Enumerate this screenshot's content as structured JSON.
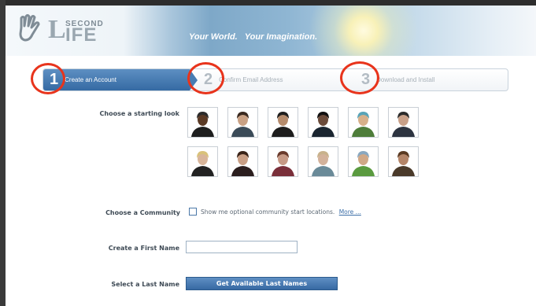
{
  "header": {
    "logo_second": "SECOND",
    "logo_life": "LIFE",
    "tagline": "Your World.   Your Imagination."
  },
  "steps": [
    {
      "number": "1",
      "label": "Create an Account",
      "active": true
    },
    {
      "number": "2",
      "label": "Confirm Email Address",
      "active": false
    },
    {
      "number": "3",
      "label": "Download and Install",
      "active": false
    }
  ],
  "form": {
    "look_label": "Choose a starting look",
    "avatars": [
      "avatar-man-suit",
      "avatar-woman-sunglasses",
      "avatar-man-dark-hair",
      "avatar-woman-black-hair",
      "avatar-furry-hat",
      "avatar-man-short-hair",
      "avatar-woman-blonde",
      "avatar-woman-dark-hair",
      "avatar-woman-red",
      "avatar-woman-light-hair",
      "avatar-man-colorful",
      "avatar-woman-brown-hair"
    ],
    "community_label": "Choose a Community",
    "community_checkbox_text": "Show me optional community start locations.",
    "community_more_link": "More ...",
    "first_name_label": "Create a First Name",
    "first_name_value": "",
    "last_name_label": "Select a Last Name",
    "last_name_button": "Get Available Last Names"
  },
  "colors": {
    "accent": "#3d6fa8",
    "annotation": "#e8341c"
  }
}
